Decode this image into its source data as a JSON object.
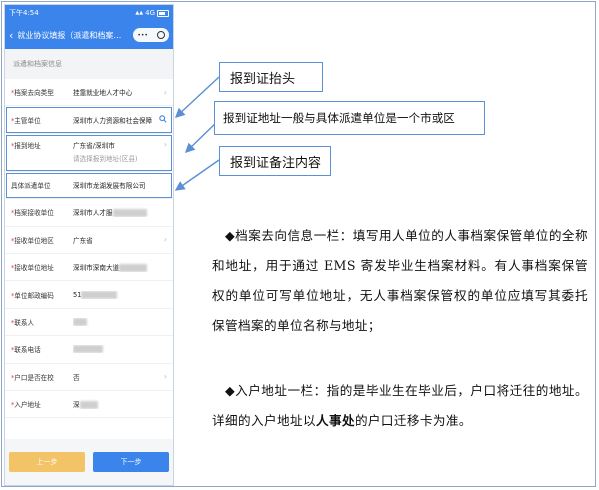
{
  "phone": {
    "status": {
      "time": "下午4:54",
      "network": "4G",
      "signal": "▲▲"
    },
    "nav": {
      "back": "‹",
      "title": "就业协议填报（派遣和档案…",
      "more": "•••"
    },
    "section_title": "派遣和档案信息",
    "rows": [
      {
        "label": "档案去向类型",
        "required": true,
        "value": "挂靠就业地人才中心",
        "icon": "chevron-right"
      },
      {
        "label": "主管单位",
        "required": true,
        "value": "深圳市人力资源和社会保障",
        "icon": "search"
      },
      {
        "label": "报到地址",
        "required": true,
        "value": "广东省/深圳市",
        "hint": "请选择报到地址(区县)",
        "icon": "chevron-right"
      },
      {
        "label": "具体派遣单位",
        "required": false,
        "value": "深圳市龙湖发展有限公司",
        "icon": ""
      },
      {
        "label": "档案接收单位",
        "required": true,
        "value": "深圳市人才服",
        "icon": ""
      },
      {
        "label": "接收单位地区",
        "required": true,
        "value": "广东省",
        "icon": "chevron-right"
      },
      {
        "label": "接收单位地址",
        "required": true,
        "value": "深圳市深南大道",
        "icon": ""
      },
      {
        "label": "单位邮政编码",
        "required": true,
        "value": "51",
        "icon": ""
      },
      {
        "label": "联系人",
        "required": true,
        "value": "",
        "icon": ""
      },
      {
        "label": "联系电话",
        "required": true,
        "value": "",
        "icon": ""
      },
      {
        "label": "户口是否在校",
        "required": true,
        "value": "否",
        "icon": "chevron-right"
      },
      {
        "label": "入户地址",
        "required": true,
        "value": "深",
        "icon": ""
      }
    ],
    "buttons": {
      "prev": "上一步",
      "next": "下一步"
    }
  },
  "callouts": {
    "header": "报到证抬头",
    "address": "报到证地址一般与具体派遣单位是一个市或区",
    "remark": "报到证备注内容"
  },
  "explanations": {
    "archive": "◆档案去向信息一栏：填写用人单位的人事档案保管单位的全称和地址，用于通过 EMS 寄发毕业生档案材料。有人事档案保管权的单位可写单位地址，无人事档案保管权的单位应填写其委托保管档案的单位名称与地址；",
    "household_prefix": "◆入户地址一栏：指的是毕业生在毕业后，户口将迁往的地址。详细的入户地址以",
    "household_bold": "人事处",
    "household_suffix": "的户口迁移卡为准。"
  },
  "colors": {
    "primary": "#3a84ec",
    "prev_button": "#f3c367",
    "callout_border": "#5b8fd6",
    "required": "#e03a3a"
  }
}
